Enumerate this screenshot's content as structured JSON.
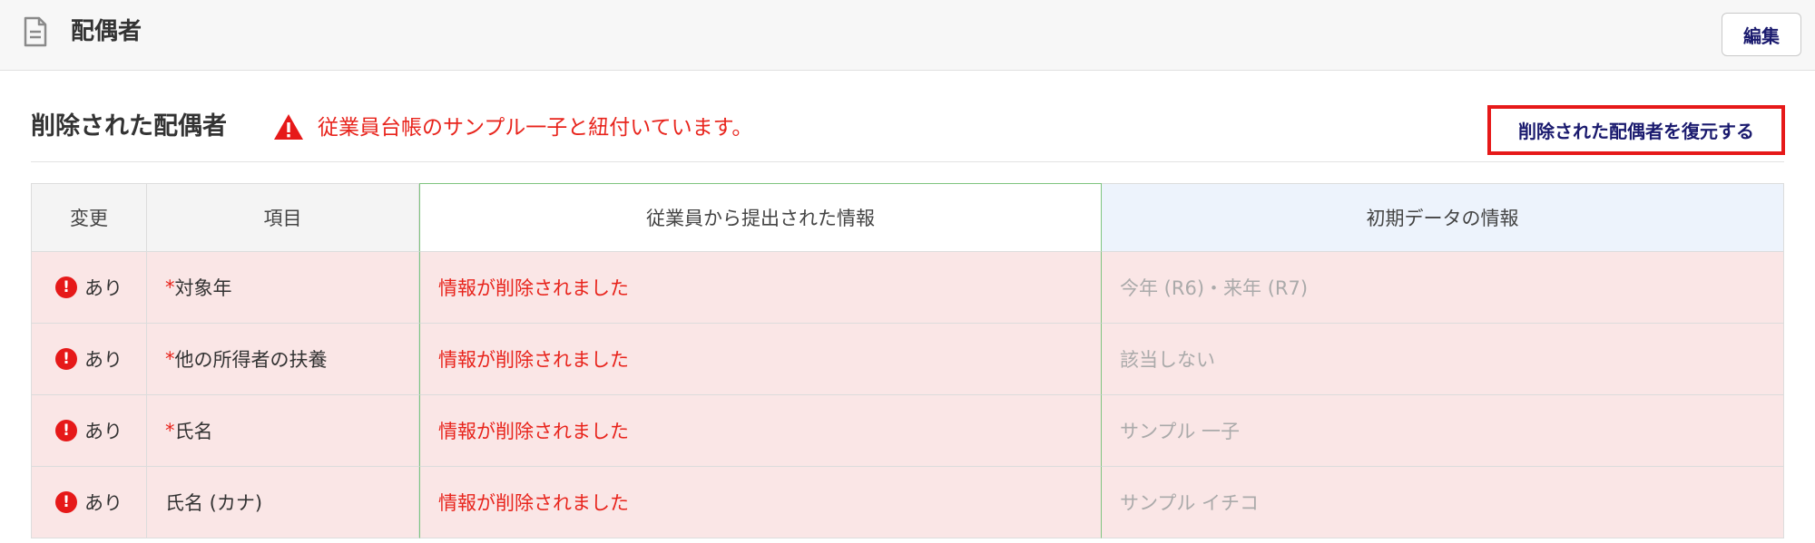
{
  "header": {
    "title": "配偶者",
    "edit_label": "編集"
  },
  "section": {
    "title": "削除された配偶者",
    "warning": "従業員台帳のサンプル一子と紐付いています。",
    "restore_label": "削除された配偶者を復元する"
  },
  "table": {
    "columns": [
      "変更",
      "項目",
      "従業員から提出された情報",
      "初期データの情報"
    ],
    "rows": [
      {
        "change": "あり",
        "required": "*",
        "item": "対象年",
        "submitted": "情報が削除されました",
        "initial": "今年 (R6)・来年 (R7)"
      },
      {
        "change": "あり",
        "required": "*",
        "item": "他の所得者の扶養",
        "submitted": "情報が削除されました",
        "initial": "該当しない"
      },
      {
        "change": "あり",
        "required": "*",
        "item": "氏名",
        "submitted": "情報が削除されました",
        "initial": "サンプル 一子"
      },
      {
        "change": "あり",
        "required": "",
        "item": "氏名 (カナ)",
        "submitted": "情報が削除されました",
        "initial": "サンプル イチコ"
      }
    ]
  },
  "colors": {
    "alert": "#e61919",
    "warning_text": "#e8241c",
    "row_bg": "#fae6e6",
    "submitted_header_border": "#7fc47f",
    "initial_header_bg": "#edf3fc"
  },
  "icons": {
    "header": "document-icon",
    "warning": "warning-triangle-icon",
    "row_alert": "exclamation-circle-icon"
  }
}
